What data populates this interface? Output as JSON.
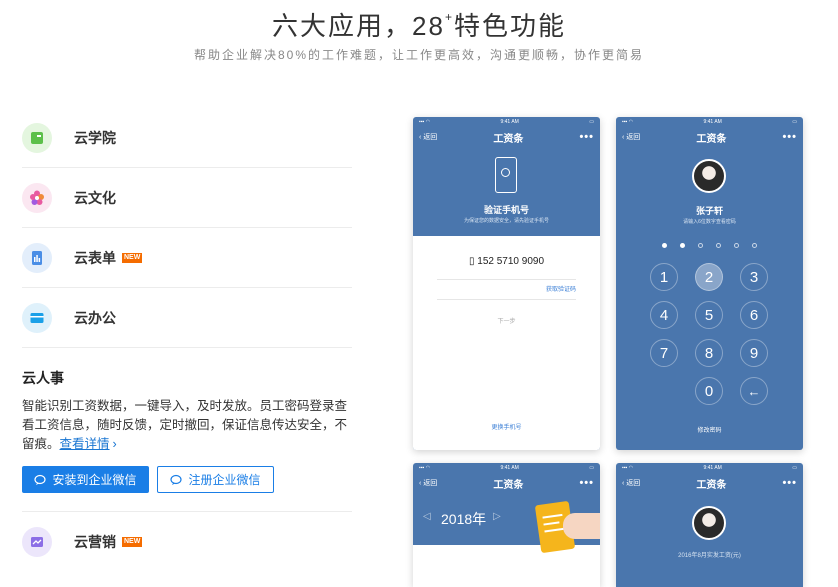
{
  "hero": {
    "title": "六大应用，28",
    "title_sup": "+",
    "title_suffix": "特色功能",
    "subtitle": "帮助企业解决80%的工作难题，让工作更高效，沟通更顺畅，协作更简易"
  },
  "features": [
    {
      "label": "云学院",
      "icon": "book-icon",
      "color": "#5cc04a"
    },
    {
      "label": "云文化",
      "icon": "flower-icon",
      "color": "#e85aa0"
    },
    {
      "label": "云表单",
      "icon": "form-icon",
      "color": "#4a8ee6",
      "badge": "NEW"
    },
    {
      "label": "云办公",
      "icon": "folder-icon",
      "color": "#1aa0e8"
    }
  ],
  "detail": {
    "title": "云人事",
    "desc": "智能识别工资数据，一键导入，及时发放。员工密码登录查看工资信息，随时反馈，定时撤回，保证信息传达安全，不留痕。",
    "link": "查看详情",
    "install_button": "安装到企业微信",
    "register_button": "注册企业微信"
  },
  "last_feature": {
    "label": "云营销",
    "icon": "chart-icon",
    "color": "#8c6ee6",
    "badge": "NEW"
  },
  "phones": {
    "time": "9:41 AM",
    "back": "返回",
    "title": "工资条",
    "more": "•••",
    "p1": {
      "heading": "验证手机号",
      "hint": "为保证您的数据安全，请先验证手机号",
      "phone_number": "152 5710 9090",
      "get_code": "获取验证码",
      "next": "下一步",
      "change_phone": "更换手机号"
    },
    "p2": {
      "name": "张子轩",
      "hint": "请输入6位数字查看密码",
      "keys": [
        "1",
        "2",
        "3",
        "4",
        "5",
        "6",
        "7",
        "8",
        "9",
        "0",
        "←"
      ],
      "change_password": "修改密码"
    },
    "p3": {
      "year": "2018年"
    },
    "p4": {
      "caption": "2016年8月实发工资(元)"
    }
  }
}
